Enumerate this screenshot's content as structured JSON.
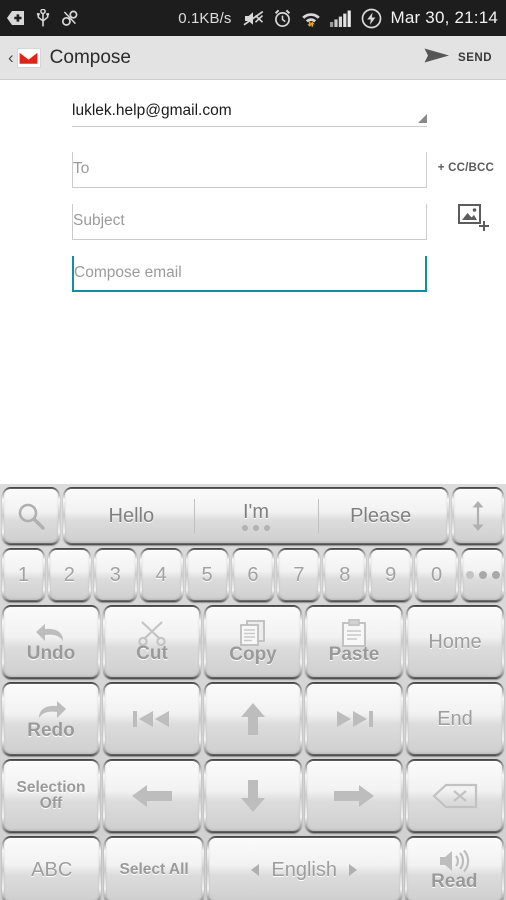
{
  "statusbar": {
    "network_speed": "0.1KB/s",
    "clock": "Mar 30, 21:14",
    "icons": [
      "download-badge-icon",
      "usb-icon",
      "link-icon",
      "mute-icon",
      "alarm-icon",
      "wifi-icon",
      "signal-icon",
      "charging-icon"
    ]
  },
  "actionbar": {
    "back_label": "‹",
    "app_icon": "gmail-icon",
    "title": "Compose",
    "send_label": "SEND",
    "send_icon": "send-arrow-icon"
  },
  "compose": {
    "from_value": "luklek.help@gmail.com",
    "from_spinner_icon": "dropdown-caret-icon",
    "to_placeholder": "To",
    "to_value": "",
    "subject_placeholder": "Subject",
    "subject_value": "",
    "body_placeholder": "Compose email",
    "body_value": "",
    "ccbcc_label": "+ CC/BCC",
    "attach_icon": "add-image-icon",
    "focus_color": "#0e8ea3"
  },
  "keyboard": {
    "suggestion_row": {
      "search_icon": "search-icon",
      "resize_icon": "resize-vertical-icon",
      "suggestions": [
        {
          "text": "Hello",
          "has_dots": false
        },
        {
          "text": "I'm",
          "has_dots": true
        },
        {
          "text": "Please",
          "has_dots": false
        }
      ]
    },
    "number_row": [
      "1",
      "2",
      "3",
      "4",
      "5",
      "6",
      "7",
      "8",
      "9",
      "0"
    ],
    "more_key_icon": "ellipsis-icon",
    "rows": [
      [
        {
          "label": "Undo",
          "icon": "undo-arrow-icon"
        },
        {
          "label": "Cut",
          "icon": "scissors-icon"
        },
        {
          "label": "Copy",
          "icon": "copy-pages-icon"
        },
        {
          "label": "Paste",
          "icon": "clipboard-icon"
        },
        {
          "label": "Home",
          "icon": ""
        }
      ],
      [
        {
          "label": "Redo",
          "icon": "redo-arrow-icon"
        },
        {
          "label": "",
          "icon": "skip-back-icon"
        },
        {
          "label": "",
          "icon": "arrow-up-icon"
        },
        {
          "label": "",
          "icon": "skip-forward-icon"
        },
        {
          "label": "End",
          "icon": ""
        }
      ],
      [
        {
          "label": "Selection Off",
          "icon": ""
        },
        {
          "label": "",
          "icon": "arrow-left-icon"
        },
        {
          "label": "",
          "icon": "arrow-down-icon"
        },
        {
          "label": "",
          "icon": "arrow-right-icon"
        },
        {
          "label": "",
          "icon": "backspace-icon"
        }
      ]
    ],
    "bottom_row": {
      "abc_label": "ABC",
      "select_all_label": "Select All",
      "language_label": "English",
      "prev_lang_icon": "triangle-left-icon",
      "next_lang_icon": "triangle-right-icon",
      "read_label": "Read",
      "read_icon": "speaker-icon"
    }
  }
}
